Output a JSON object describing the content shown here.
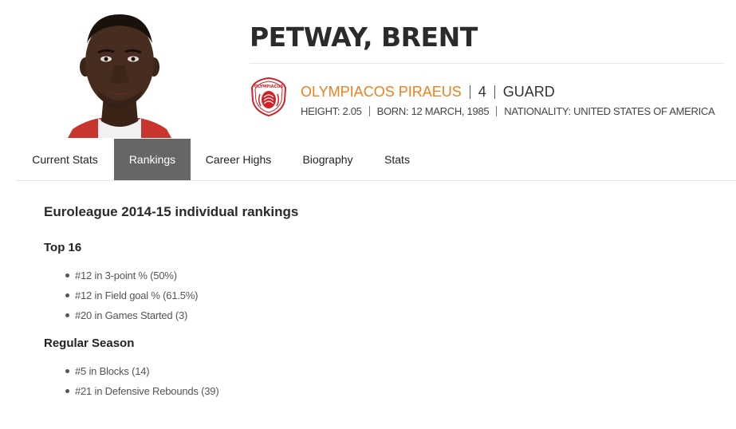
{
  "player": {
    "name": "PETWAY, BRENT",
    "club": "OLYMPIACOS PIRAEUS",
    "number": "4",
    "position": "GUARD",
    "height": "HEIGHT: 2.05",
    "born": "BORN: 12 MARCH, 1985",
    "nationality": "NATIONALITY: UNITED STATES OF AMERICA",
    "club_logo_text": "OLYMPIACOS",
    "colors": {
      "club": "#f07f1d",
      "logo_red": "#d32027",
      "active_tab": "#666666"
    }
  },
  "tabs": [
    {
      "label": "Current Stats"
    },
    {
      "label": "Rankings"
    },
    {
      "label": "Career Highs"
    },
    {
      "label": "Biography"
    },
    {
      "label": "Stats"
    }
  ],
  "active_tab": "Rankings",
  "rankings": {
    "title": "Euroleague 2014-15 individual rankings",
    "sections": [
      {
        "title": "Top 16",
        "items": [
          "#12 in 3-point % (50%)",
          "#12 in Field goal % (61.5%)",
          "#20 in Games Started (3)"
        ]
      },
      {
        "title": "Regular Season",
        "items": [
          "#5 in Blocks (14)",
          "#21 in Defensive Rebounds (39)"
        ]
      }
    ]
  }
}
